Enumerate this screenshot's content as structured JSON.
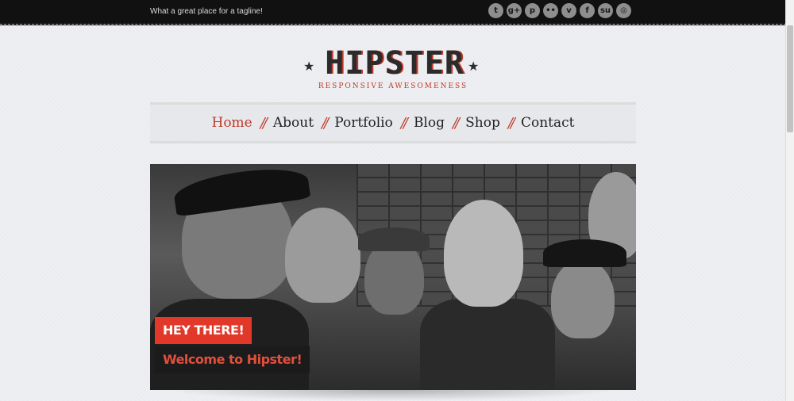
{
  "topbar": {
    "tagline": "What a great place for a tagline!",
    "social": [
      {
        "name": "twitter-icon",
        "glyph": "t"
      },
      {
        "name": "google-plus-icon",
        "glyph": "g+"
      },
      {
        "name": "pinterest-icon",
        "glyph": "p"
      },
      {
        "name": "flickr-icon",
        "glyph": "••"
      },
      {
        "name": "vimeo-icon",
        "glyph": "v"
      },
      {
        "name": "facebook-icon",
        "glyph": "f"
      },
      {
        "name": "stumbleupon-icon",
        "glyph": "su"
      },
      {
        "name": "dribbble-icon",
        "glyph": "◎"
      }
    ]
  },
  "logo": {
    "title": "HIPSTER",
    "subtitle": "RESPONSIVE AWESOMENESS",
    "accent": "#c0392b"
  },
  "nav": {
    "items": [
      "Home",
      "About",
      "Portfolio",
      "Blog",
      "Shop",
      "Contact"
    ],
    "separator": "//",
    "active": "Home"
  },
  "hero": {
    "caption_top": "HEY THERE!",
    "caption_bottom": "Welcome to Hipster!"
  }
}
